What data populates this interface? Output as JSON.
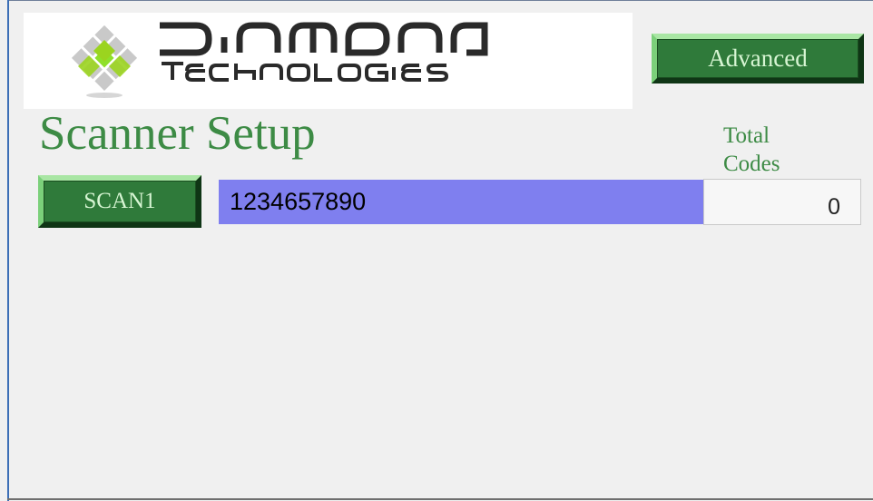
{
  "logo": {
    "brand_main": "DIAMOND",
    "brand_sub": "TECHNOLOGIES",
    "colors": {
      "diamond_green": "#8fe02a",
      "diamond_gray": "#9a9a9a",
      "wordmark": "#2a2a2a"
    }
  },
  "toolbar": {
    "advanced_label": "Advanced"
  },
  "page": {
    "title": "Scanner Setup"
  },
  "scanner": {
    "button_label": "SCAN1",
    "code_value": "1234657890",
    "total_label": "Total Codes",
    "total_value": "0"
  },
  "colors": {
    "button_green": "#2f7a3a",
    "title_green": "#3d8b45",
    "code_field_bg": "#7f7fef",
    "window_bg": "#f0f0f0"
  }
}
